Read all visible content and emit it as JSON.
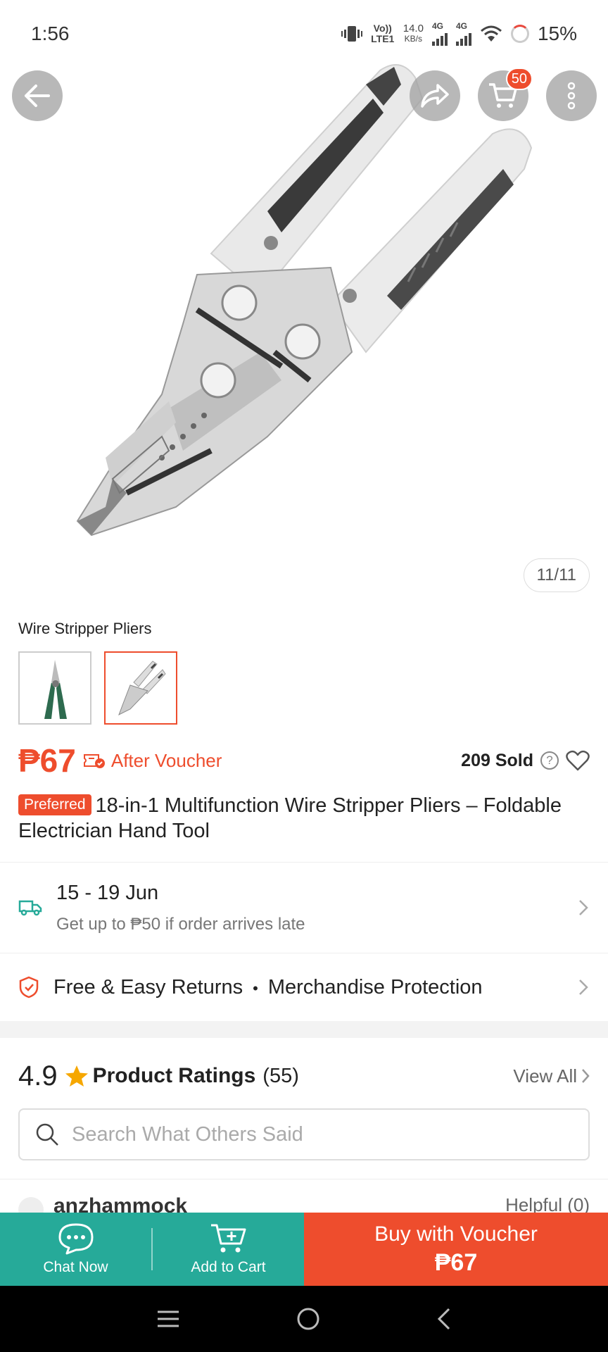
{
  "status_bar": {
    "time": "1:56",
    "volte": "Vo)) LTE1",
    "speed_value": "14.0",
    "speed_unit": "KB/s",
    "network_1": "4G",
    "network_2": "4G",
    "battery": "15%"
  },
  "header": {
    "cart_count": "50"
  },
  "gallery": {
    "counter": "11/11",
    "variant_label": "Wire Stripper Pliers"
  },
  "price": {
    "amount": "₱67",
    "after_voucher": "After Voucher",
    "sold": "209 Sold"
  },
  "product": {
    "badge": "Preferred",
    "title": "18-in-1 Multifunction Wire Stripper Pliers – Foldable Electrician Hand Tool"
  },
  "shipping": {
    "dates": "15 - 19 Jun",
    "guarantee": "Get up to ₱50 if order arrives late"
  },
  "returns": {
    "label_1": "Free & Easy Returns",
    "label_2": "Merchandise Protection"
  },
  "ratings": {
    "score": "4.9",
    "label": "Product Ratings",
    "count": "(55)",
    "view_all": "View All",
    "search_placeholder": "Search What Others Said"
  },
  "review_peek": {
    "user": "anzhammock",
    "helpful": "Helpful (0)"
  },
  "bottom_bar": {
    "chat_label": "Chat Now",
    "cart_label": "Add to Cart",
    "buy_label": "Buy with Voucher",
    "buy_price": "₱67"
  },
  "colors": {
    "brand": "#ee4d2d",
    "teal": "#26aa99"
  }
}
